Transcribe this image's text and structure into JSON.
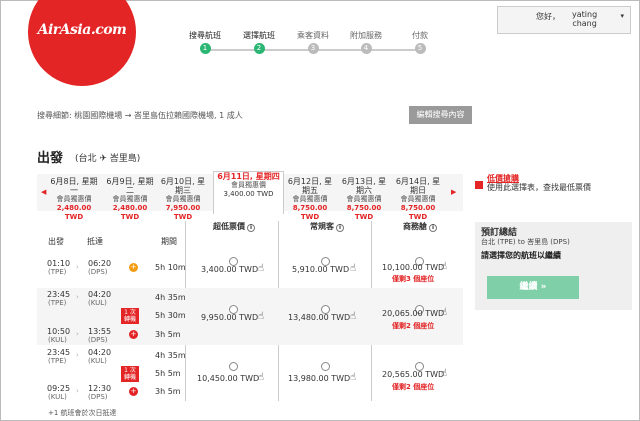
{
  "brand": {
    "logo_text": "AirAsia.com",
    "color": "#e32526"
  },
  "steps": [
    {
      "label": "搜尋航班",
      "num": "1",
      "active": true
    },
    {
      "label": "選擇航班",
      "num": "2",
      "active": true
    },
    {
      "label": "乘客資料",
      "num": "3",
      "active": false
    },
    {
      "label": "附加服務",
      "num": "4",
      "active": false
    },
    {
      "label": "付款",
      "num": "5",
      "active": false
    }
  ],
  "user": {
    "greeting": "您好，",
    "name_line1": "yating",
    "name_line2": "chang",
    "caret": "▾"
  },
  "search": {
    "summary": "搜尋細節: 桃園國際機場 → 峇里島伍拉賴國際機場, 1 成人",
    "edit_label": "編輯搜尋內容"
  },
  "section": {
    "title": "出發",
    "route": "(台北 ✈ 峇里島)"
  },
  "date_bar": {
    "prev": "◀",
    "next": "▶",
    "dates": [
      {
        "date": "6月8日, 星期一",
        "price": "2,480.00 TWD",
        "sub": "會員獨惠價"
      },
      {
        "date": "6月9日, 星期二",
        "price": "2,480.00 TWD",
        "sub": "會員獨惠價"
      },
      {
        "date": "6月10日, 星期三",
        "price": "7,950.00 TWD",
        "sub": "會員獨惠價"
      },
      {
        "date": "6月11日, 星期四",
        "price": "3,400.00 TWD",
        "sub": "會員獨惠價",
        "selected": true
      },
      {
        "date": "6月12日, 星期五",
        "price": "8,750.00 TWD",
        "sub": "會員獨惠價"
      },
      {
        "date": "6月13日, 星期六",
        "price": "8,750.00 TWD",
        "sub": "會員獨惠價"
      },
      {
        "date": "6月14日, 星期日",
        "price": "8,750.00 TWD",
        "sub": "會員獨惠價"
      }
    ]
  },
  "legend": {
    "title": "低價搶購",
    "text": "使用此選擇表，查找最低票價"
  },
  "table": {
    "headers": {
      "depart": "出發",
      "arrive": "抵達",
      "duration": "期間",
      "fare1": "超低票價",
      "fare2": "常規客",
      "fare3": "商務艙",
      "info": "i"
    },
    "rows": [
      {
        "dep_time": "01:10",
        "dep_ap": "(TPE)",
        "arr_time": "06:20",
        "arr_ap": "(DPS)",
        "dur": "5h 10m",
        "f1": "3,400.00 TWD",
        "f2": "5,910.00 TWD",
        "f3": "10,100.00 TWD",
        "seats": "僅剩3 個座位"
      },
      {
        "dep_time": "23:45",
        "dep_ap": "(TPE)",
        "arr_time": "04:20",
        "arr_ap": "(KUL)",
        "dur": "4h 35m",
        "dep2_time": "10:50",
        "dep2_ap": "(KUL)",
        "arr2_time": "13:55",
        "arr2_ap": "(DPS)",
        "dur2": "3h 5m",
        "mid_dur": "5h 30m",
        "badge": "1 次轉機",
        "f1": "9,950.00 TWD",
        "f2": "13,480.00 TWD",
        "f3": "20,065.00 TWD",
        "seats": "僅剩2 個座位"
      },
      {
        "dep_time": "23:45",
        "dep_ap": "(TPE)",
        "arr_time": "04:20",
        "arr_ap": "(KUL)",
        "dur": "4h 35m",
        "dep2_time": "09:25",
        "dep2_ap": "(KUL)",
        "arr2_time": "12:30",
        "arr2_ap": "(DPS)",
        "dur2": "3h 5m",
        "mid_dur": "5h 5m",
        "badge": "1 次轉機",
        "f1": "10,450.00 TWD",
        "f2": "13,980.00 TWD",
        "f3": "20,565.00 TWD",
        "seats": "僅剩2 個座位"
      }
    ],
    "footnote": "+1 航班會於次日抵達"
  },
  "summary_box": {
    "title": "預訂總結",
    "route": "台北 (TPE) to 峇里島 (DPS)",
    "prompt": "請選擇您的航班以繼續",
    "continue": "繼續 »"
  }
}
